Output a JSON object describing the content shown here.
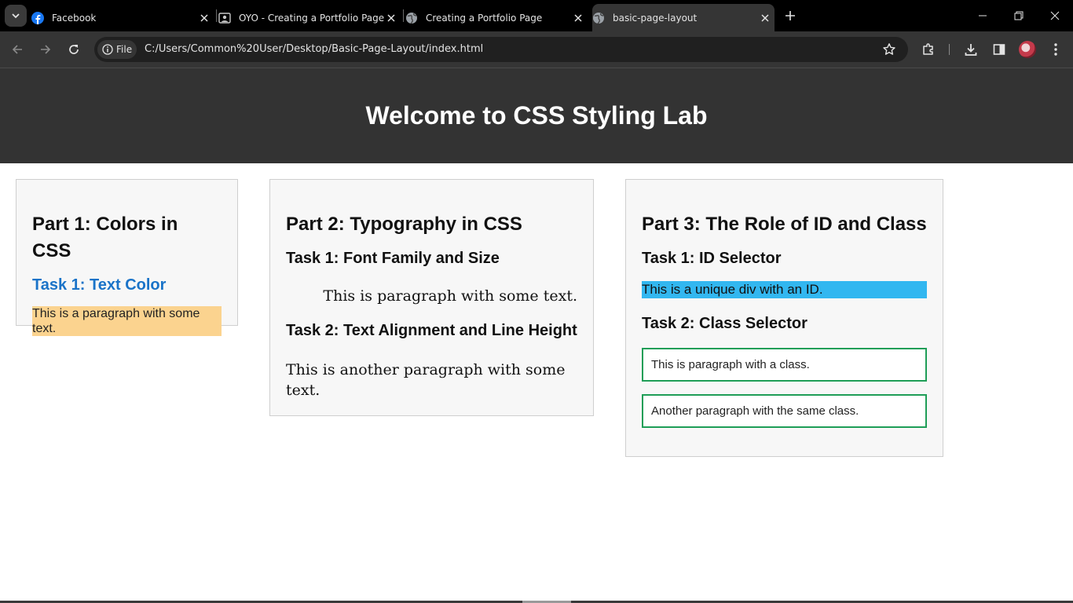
{
  "browser": {
    "tabs": [
      {
        "title": "Facebook",
        "icon": "facebook-icon",
        "active": false
      },
      {
        "title": "OYO - Creating a Portfolio Page",
        "icon": "portrait-icon",
        "active": false
      },
      {
        "title": "Creating a Portfolio Page",
        "icon": "globe-icon",
        "active": false
      },
      {
        "title": "basic-page-layout",
        "icon": "globe-icon",
        "active": true
      }
    ],
    "site_chip_label": "File",
    "url": "C:/Users/Common%20User/Desktop/Basic-Page-Layout/index.html",
    "colors": {
      "tabstrip": "#000000",
      "toolbar": "#353535",
      "omnibox": "#202020"
    }
  },
  "page": {
    "header_title": "Welcome to CSS Styling Lab",
    "part1": {
      "heading": "Part 1: Colors in CSS",
      "task1_title": "Task 1: Text Color",
      "paragraph": "This is a paragraph with some text."
    },
    "part2": {
      "heading": "Part 2: Typography in CSS",
      "task1_title": "Task 1: Font Family and Size",
      "paragraph1": "This is paragraph with some text.",
      "task2_title": "Task 2: Text Alignment and Line Height",
      "paragraph2": "This is another paragraph with some text."
    },
    "part3": {
      "heading": "Part 3: The Role of ID and Class",
      "task1_title": "Task 1: ID Selector",
      "unique_div": "This is a unique div with an ID.",
      "task2_title": "Task 2: Class Selector",
      "class_para1": "This is paragraph with a class.",
      "class_para2": "Another paragraph with the same class."
    },
    "colors": {
      "header_bg": "#333333",
      "task_title_blue": "#1a73c8",
      "highlight_bg": "#fbd38f",
      "unique_div_bg": "#32b7f0",
      "class_border": "#1e9e57"
    }
  }
}
